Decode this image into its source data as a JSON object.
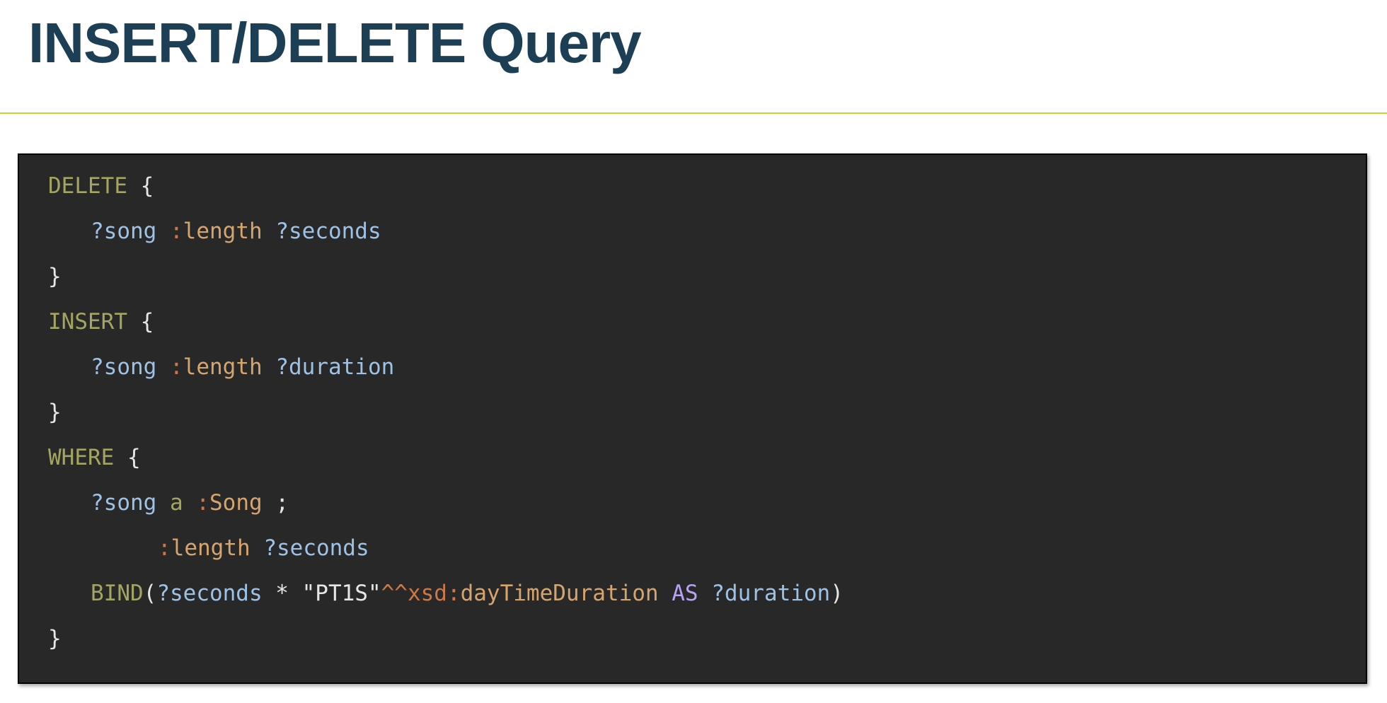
{
  "slide": {
    "title": "INSERT/DELETE Query"
  },
  "colors": {
    "title": "#1c3f55",
    "rule": "#c8d42a",
    "code_background": "#282828",
    "keyword": "#a3a561",
    "variable": "#9dc2e6",
    "predicate": "#d6a56f",
    "prefix": "#cc7847",
    "as_keyword": "#b9a2f4",
    "plain": "#e6e6e6"
  },
  "code": {
    "language": "SPARQL",
    "lines": [
      {
        "indent": 0,
        "tokens": [
          {
            "t": "DELETE",
            "c": "kw"
          },
          {
            "t": " ",
            "c": "punc"
          },
          {
            "t": "{",
            "c": "punc"
          }
        ]
      },
      {
        "indent": 1,
        "tokens": [
          {
            "t": "?song",
            "c": "var"
          },
          {
            "t": " ",
            "c": "punc"
          },
          {
            "t": ":",
            "c": "pfx"
          },
          {
            "t": "length",
            "c": "pred"
          },
          {
            "t": " ",
            "c": "punc"
          },
          {
            "t": "?seconds",
            "c": "var"
          }
        ]
      },
      {
        "indent": 0,
        "tokens": [
          {
            "t": "}",
            "c": "punc"
          }
        ]
      },
      {
        "indent": 0,
        "tokens": [
          {
            "t": "INSERT",
            "c": "kw"
          },
          {
            "t": " ",
            "c": "punc"
          },
          {
            "t": "{",
            "c": "punc"
          }
        ]
      },
      {
        "indent": 1,
        "tokens": [
          {
            "t": "?song",
            "c": "var"
          },
          {
            "t": " ",
            "c": "punc"
          },
          {
            "t": ":",
            "c": "pfx"
          },
          {
            "t": "length",
            "c": "pred"
          },
          {
            "t": " ",
            "c": "punc"
          },
          {
            "t": "?duration",
            "c": "var"
          }
        ]
      },
      {
        "indent": 0,
        "tokens": [
          {
            "t": "}",
            "c": "punc"
          }
        ]
      },
      {
        "indent": 0,
        "tokens": [
          {
            "t": "WHERE",
            "c": "kw"
          },
          {
            "t": " ",
            "c": "punc"
          },
          {
            "t": "{",
            "c": "punc"
          }
        ]
      },
      {
        "indent": 1,
        "tokens": [
          {
            "t": "?song",
            "c": "var"
          },
          {
            "t": " ",
            "c": "punc"
          },
          {
            "t": "a",
            "c": "a"
          },
          {
            "t": " ",
            "c": "punc"
          },
          {
            "t": ":",
            "c": "pfx"
          },
          {
            "t": "Song",
            "c": "pred"
          },
          {
            "t": " ;",
            "c": "punc"
          }
        ]
      },
      {
        "indent": 2,
        "tokens": [
          {
            "t": ":",
            "c": "pfx"
          },
          {
            "t": "length",
            "c": "pred"
          },
          {
            "t": " ",
            "c": "punc"
          },
          {
            "t": "?seconds",
            "c": "var"
          }
        ]
      },
      {
        "indent": 1,
        "tokens": [
          {
            "t": "BIND",
            "c": "kw"
          },
          {
            "t": "(",
            "c": "punc"
          },
          {
            "t": "?seconds",
            "c": "var"
          },
          {
            "t": " * ",
            "c": "punc"
          },
          {
            "t": "\"PT1S\"",
            "c": "str"
          },
          {
            "t": "^^xsd:",
            "c": "pfx"
          },
          {
            "t": "dayTimeDuration",
            "c": "pred"
          },
          {
            "t": " ",
            "c": "punc"
          },
          {
            "t": "AS",
            "c": "as"
          },
          {
            "t": " ",
            "c": "punc"
          },
          {
            "t": "?duration",
            "c": "var"
          },
          {
            "t": ")",
            "c": "punc"
          }
        ]
      },
      {
        "indent": 0,
        "tokens": [
          {
            "t": "}",
            "c": "punc"
          }
        ]
      }
    ]
  }
}
